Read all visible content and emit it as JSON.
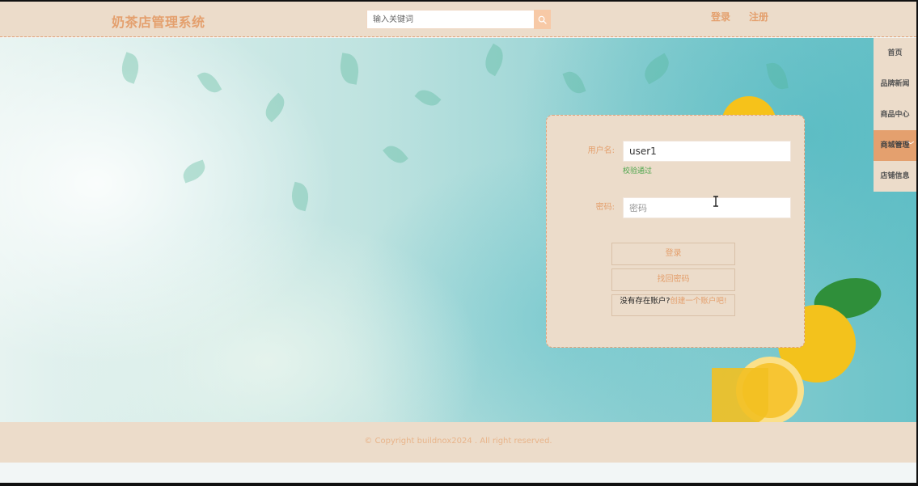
{
  "header": {
    "brand": "奶茶店管理系统",
    "search": {
      "placeholder": "输入关键词",
      "value": ""
    },
    "login_link": "登录",
    "register_link": "注册"
  },
  "side_nav": {
    "items": [
      {
        "label": "首页"
      },
      {
        "label": "品牌新闻"
      },
      {
        "label": "商品中心"
      },
      {
        "label": "商城管理",
        "active": true
      },
      {
        "label": "店铺信息"
      }
    ]
  },
  "login_form": {
    "username_label": "用户名:",
    "username_value": "user1",
    "username_tip": "校验通过",
    "password_label": "密码:",
    "password_placeholder": "密码",
    "login_button": "登录",
    "forgot_button": "找回密码",
    "signup_prompt": "没有存在账户?",
    "signup_link": "创建一个账户吧!"
  },
  "footer": {
    "copyright": "© Copyright buildnox2024 . All right reserved."
  },
  "colors": {
    "accent": "#e4a06e",
    "panel_bg": "#ecdcca",
    "valid": "#4aa44a"
  }
}
